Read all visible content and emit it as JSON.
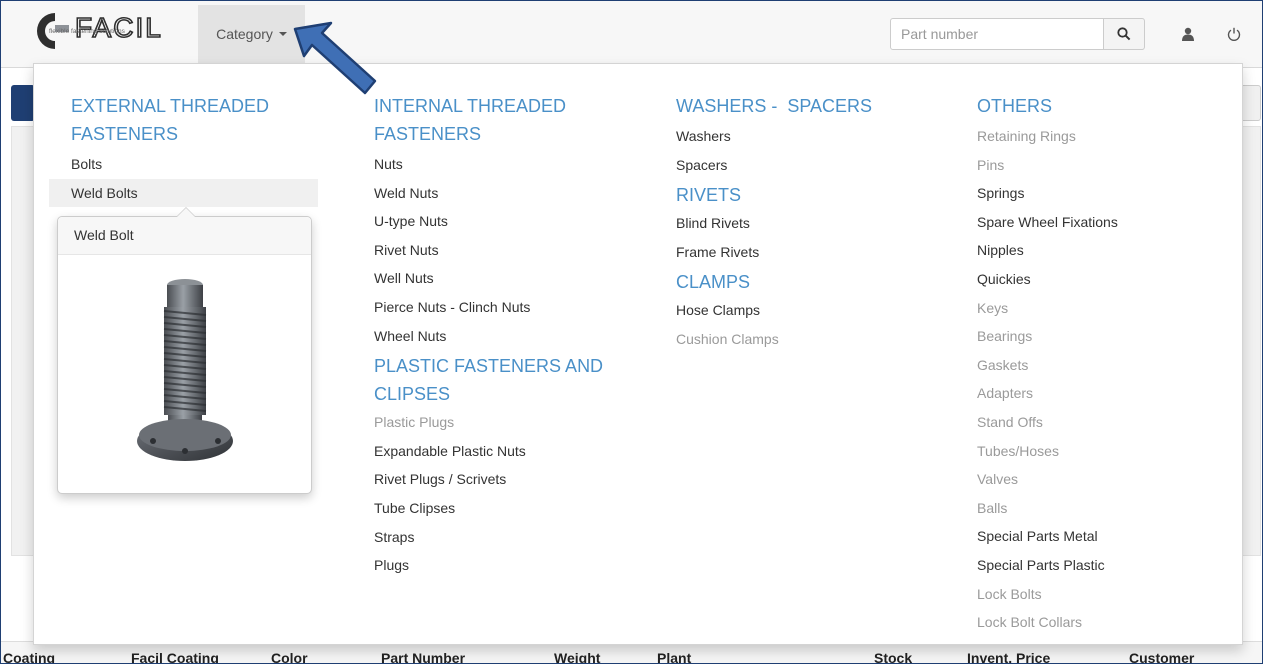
{
  "navbar": {
    "logo_text": "FACIL",
    "logo_tagline": "flexible fastening solutions",
    "category_label": "Category",
    "search_placeholder": "Part number"
  },
  "mega_menu": {
    "col1": {
      "title": "EXTERNAL THREADED FASTENERS",
      "items": [
        "Bolts",
        "Weld Bolts"
      ]
    },
    "col2": {
      "title": "INTERNAL THREADED FASTENERS",
      "items": [
        "Nuts",
        "Weld Nuts",
        "U-type Nuts",
        "Rivet Nuts",
        "Well Nuts",
        "Pierce Nuts - Clinch Nuts",
        "Wheel Nuts"
      ],
      "subtitle": "PLASTIC FASTENERS AND CLIPSES",
      "sub_items": [
        "Plastic Plugs",
        "Expandable Plastic Nuts",
        "Rivet Plugs / Scrivets",
        "Tube Clipses",
        "Straps",
        "Plugs"
      ]
    },
    "col3": {
      "title": "WASHERS -  SPACERS",
      "items": [
        "Washers",
        "Spacers"
      ],
      "rivets_title": "RIVETS",
      "rivets_items": [
        "Blind Rivets",
        "Frame Rivets"
      ],
      "clamps_title": "CLAMPS",
      "clamps_items": [
        "Hose Clamps",
        "Cushion Clamps"
      ]
    },
    "col4": {
      "title": "OTHERS",
      "items": [
        "Retaining Rings",
        "Pins",
        "Springs",
        "Spare Wheel Fixations",
        "Nipples",
        "Quickies",
        "Keys",
        "Bearings",
        "Gaskets",
        "Adapters",
        "Stand Offs",
        "Tubes/Hoses",
        "Valves",
        "Balls",
        "Special Parts Metal",
        "Special Parts Plastic",
        "Lock Bolts",
        "Lock Bolt Collars"
      ]
    }
  },
  "popover": {
    "title": "Weld Bolt"
  },
  "table": {
    "headers": [
      "Coating",
      "Facil Coating",
      "Color",
      "Part Number",
      "Weight",
      "Plant",
      "Stock",
      "Invent. Price",
      "Customer"
    ]
  },
  "colors": {
    "accent": "#4a90c8",
    "brand_dark": "#1f3f73",
    "annotation_arrow": "#3f6fb5"
  },
  "icons": [
    "search-icon",
    "user-icon",
    "power-icon"
  ]
}
